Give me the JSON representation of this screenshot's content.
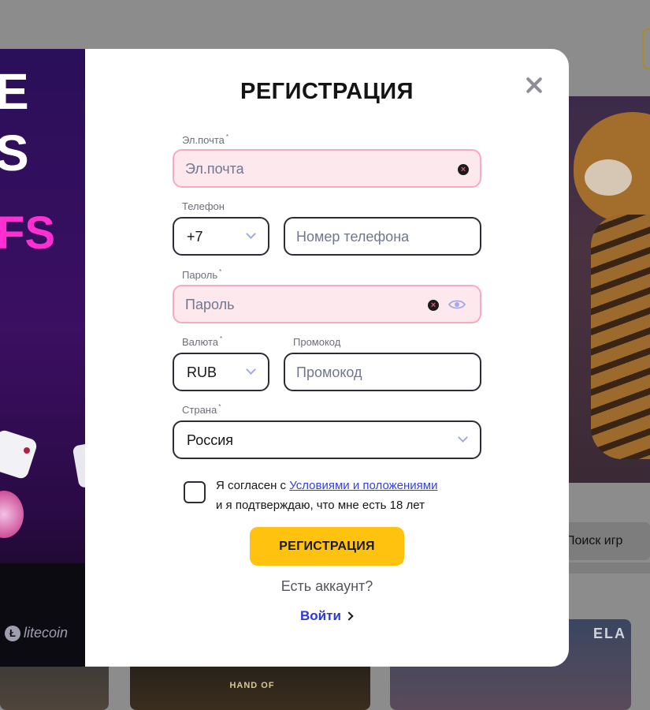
{
  "background": {
    "search_label": "Поиск игр",
    "tile_hand_text": "HAND OF",
    "tile_ela_text": "ELA"
  },
  "promo": {
    "letter_top": "E",
    "letter_mid": "S",
    "fs_text": "FS",
    "crypto_label": "litecoin",
    "crypto_symbol": "Ł"
  },
  "modal": {
    "title": "РЕГИСТРАЦИЯ",
    "close_icon": "close-icon",
    "email": {
      "label": "Эл.почта",
      "required_mark": "*",
      "placeholder": "Эл.почта",
      "state": "error"
    },
    "phone": {
      "label": "Телефон",
      "code": "+7",
      "placeholder": "Номер телефона"
    },
    "password": {
      "label": "Пароль",
      "required_mark": "*",
      "placeholder": "Пароль",
      "state": "error"
    },
    "currency": {
      "label": "Валюта",
      "required_mark": "*",
      "value": "RUB"
    },
    "promo": {
      "label": "Промокод",
      "placeholder": "Промокод"
    },
    "country": {
      "label": "Страна",
      "required_mark": "*",
      "value": "Россия"
    },
    "terms": {
      "prefix": "Я согласен с ",
      "link": "Условиями и положениями",
      "suffix": "и я подтверждаю, что мне есть 18 лет",
      "checked": false
    },
    "submit_label": "РЕГИСТРАЦИЯ",
    "have_account": "Есть аккаунт?",
    "login_label": "Войти"
  },
  "colors": {
    "accent_yellow": "#ffc20f",
    "link_blue": "#3441e6",
    "error_border": "#f6a9c1",
    "error_fill": "#fde8ee",
    "promo_magenta": "#ff2fd1"
  }
}
